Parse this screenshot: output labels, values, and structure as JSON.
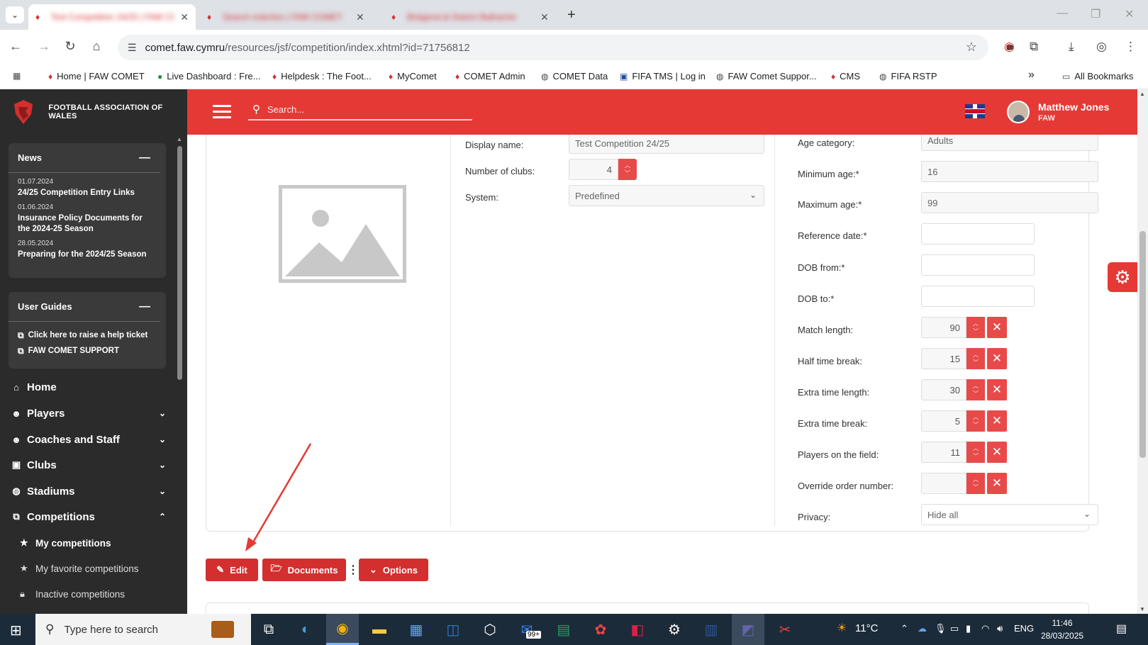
{
  "browser": {
    "tabs": [
      {
        "title": "Test Competition 24/25 | FAW COMET"
      },
      {
        "title": "Search matches | FAW COMET"
      },
      {
        "title": "Bridgend & District Balharrier"
      }
    ],
    "new_tab": "+",
    "url_host": "comet.faw.cymru",
    "url_path": "/resources/jsf/competition/index.xhtml?id=71756812",
    "extension_badge": "10",
    "bookmarks": [
      {
        "label": "Home | FAW COMET",
        "icon": "faw-dragon-icon"
      },
      {
        "label": "Live Dashboard : Fre...",
        "icon": "live-dashboard-icon"
      },
      {
        "label": "Helpdesk : The Foot...",
        "icon": "faw-dragon-icon"
      },
      {
        "label": "MyComet",
        "icon": "faw-dragon-icon"
      },
      {
        "label": "COMET Admin",
        "icon": "faw-dragon-icon"
      },
      {
        "label": "COMET Data",
        "icon": "globe-icon"
      },
      {
        "label": "FIFA TMS | Log in",
        "icon": "fifa-icon"
      },
      {
        "label": "FAW Comet Suppor...",
        "icon": "globe-icon"
      },
      {
        "label": "CMS",
        "icon": "faw-dragon-icon"
      },
      {
        "label": "FIFA RSTP",
        "icon": "globe-icon"
      }
    ],
    "more_bookmarks": "»",
    "all_bookmarks": "All Bookmarks"
  },
  "header": {
    "org_name": "FOOTBALL ASSOCIATION OF WALES",
    "search_placeholder": "Search...",
    "user_name": "Matthew Jones",
    "user_org": "FAW"
  },
  "sidebar": {
    "news": {
      "title": "News",
      "items": [
        {
          "date": "01.07.2024",
          "title": "24/25 Competition Entry Links"
        },
        {
          "date": "01.06.2024",
          "title": "Insurance Policy Documents for the 2024-25 Season"
        },
        {
          "date": "28.05.2024",
          "title": "Preparing for the 2024/25 Season"
        }
      ]
    },
    "guides": {
      "title": "User Guides",
      "items": [
        {
          "label": "Click here to raise a help ticket"
        },
        {
          "label": "FAW COMET SUPPORT"
        }
      ]
    },
    "nav": [
      {
        "label": "Home",
        "icon": "home-icon"
      },
      {
        "label": "Players",
        "icon": "players-icon"
      },
      {
        "label": "Coaches and Staff",
        "icon": "coaches-icon"
      },
      {
        "label": "Clubs",
        "icon": "clubs-icon"
      },
      {
        "label": "Stadiums",
        "icon": "stadiums-icon"
      },
      {
        "label": "Competitions",
        "icon": "competitions-icon"
      }
    ],
    "competitions_sub": [
      {
        "label": "My competitions"
      },
      {
        "label": "My favorite competitions"
      },
      {
        "label": "Inactive competitions"
      }
    ]
  },
  "form": {
    "display_name": {
      "label": "Display name:",
      "value": "Test Competition 24/25"
    },
    "number_of_clubs": {
      "label": "Number of clubs:",
      "value": "4"
    },
    "system": {
      "label": "System:",
      "value": "Predefined"
    },
    "age_category": {
      "label": "Age category:",
      "value": "Adults"
    },
    "minimum_age": {
      "label": "Minimum age:*",
      "value": "16"
    },
    "maximum_age": {
      "label": "Maximum age:*",
      "value": "99"
    },
    "reference_date": {
      "label": "Reference date:*",
      "value": ""
    },
    "dob_from": {
      "label": "DOB from:*",
      "value": ""
    },
    "dob_to": {
      "label": "DOB to:*",
      "value": ""
    },
    "match_length": {
      "label": "Match length:",
      "value": "90"
    },
    "half_time_break": {
      "label": "Half time break:",
      "value": "15"
    },
    "extra_time_length": {
      "label": "Extra time length:",
      "value": "30"
    },
    "extra_time_break": {
      "label": "Extra time break:",
      "value": "5"
    },
    "players_on_field": {
      "label": "Players on the field:",
      "value": "11"
    },
    "override_order_number": {
      "label": "Override order number:",
      "value": ""
    },
    "privacy": {
      "label": "Privacy:",
      "value": "Hide all"
    }
  },
  "actions": {
    "edit": "Edit",
    "documents": "Documents",
    "options": "Options"
  },
  "taskbar": {
    "search_placeholder": "Type here to search",
    "mail_badge": "99+",
    "weather": "11°C",
    "language": "ENG",
    "time": "11:46",
    "date": "28/03/2025"
  },
  "colors": {
    "brand_red": "#e53935",
    "button_red": "#d32f2f",
    "sidebar_bg": "#2b2b2b",
    "annotation_arrow": "#e53935"
  }
}
